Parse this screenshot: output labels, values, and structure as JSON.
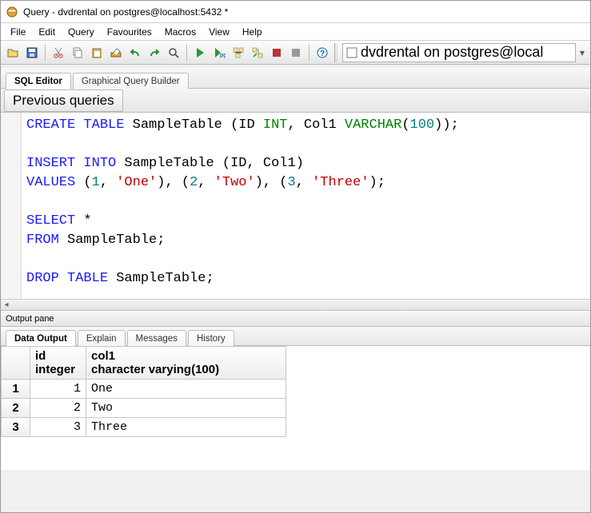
{
  "window": {
    "title": "Query - dvdrental on postgres@localhost:5432 *"
  },
  "menu": {
    "items": [
      "File",
      "Edit",
      "Query",
      "Favourites",
      "Macros",
      "View",
      "Help"
    ]
  },
  "connection": {
    "label": "dvdrental on postgres@local"
  },
  "editor_tabs": {
    "items": [
      "SQL Editor",
      "Graphical Query Builder"
    ],
    "active": 0
  },
  "prev_queries": {
    "label": "Previous queries"
  },
  "sql": {
    "tokens": [
      [
        {
          "t": "CREATE",
          "c": "kw"
        },
        {
          "t": " "
        },
        {
          "t": "TABLE",
          "c": "kw"
        },
        {
          "t": " SampleTable "
        },
        {
          "t": "(",
          "c": ""
        },
        {
          "t": "ID "
        },
        {
          "t": "INT",
          "c": "ty"
        },
        {
          "t": ","
        },
        {
          "t": " Col1 "
        },
        {
          "t": "VARCHAR",
          "c": "ty"
        },
        {
          "t": "("
        },
        {
          "t": "100",
          "c": "num"
        },
        {
          "t": ")"
        },
        {
          "t": ")"
        },
        {
          "t": ";"
        }
      ],
      [],
      [
        {
          "t": "INSERT",
          "c": "kw"
        },
        {
          "t": " "
        },
        {
          "t": "INTO",
          "c": "kw"
        },
        {
          "t": " SampleTable "
        },
        {
          "t": "("
        },
        {
          "t": "ID"
        },
        {
          "t": ","
        },
        {
          "t": " Col1"
        },
        {
          "t": ")"
        }
      ],
      [
        {
          "t": "VALUES",
          "c": "kw"
        },
        {
          "t": " "
        },
        {
          "t": "("
        },
        {
          "t": "1",
          "c": "num"
        },
        {
          "t": ","
        },
        {
          "t": " "
        },
        {
          "t": "'One'",
          "c": "str"
        },
        {
          "t": ")"
        },
        {
          "t": ","
        },
        {
          "t": " "
        },
        {
          "t": "("
        },
        {
          "t": "2",
          "c": "num"
        },
        {
          "t": ","
        },
        {
          "t": " "
        },
        {
          "t": "'Two'",
          "c": "str"
        },
        {
          "t": ")"
        },
        {
          "t": ","
        },
        {
          "t": " "
        },
        {
          "t": "("
        },
        {
          "t": "3",
          "c": "num"
        },
        {
          "t": ","
        },
        {
          "t": " "
        },
        {
          "t": "'Three'",
          "c": "str"
        },
        {
          "t": ")"
        },
        {
          "t": ";"
        }
      ],
      [],
      [
        {
          "t": "SELECT",
          "c": "kw"
        },
        {
          "t": " "
        },
        {
          "t": "*",
          "c": ""
        }
      ],
      [
        {
          "t": "FROM",
          "c": "kw"
        },
        {
          "t": " SampleTable"
        },
        {
          "t": ";"
        }
      ],
      [],
      [
        {
          "t": "DROP",
          "c": "kw"
        },
        {
          "t": " "
        },
        {
          "t": "TABLE",
          "c": "kw"
        },
        {
          "t": " SampleTable"
        },
        {
          "t": ";"
        }
      ]
    ]
  },
  "output": {
    "pane_label": "Output pane",
    "tabs": [
      "Data Output",
      "Explain",
      "Messages",
      "History"
    ],
    "active_tab": 0,
    "columns": [
      {
        "name": "id",
        "type": "integer"
      },
      {
        "name": "col1",
        "type": "character varying(100)"
      }
    ],
    "rows": [
      {
        "n": "1",
        "id": "1",
        "col1": "One"
      },
      {
        "n": "2",
        "id": "2",
        "col1": "Two"
      },
      {
        "n": "3",
        "id": "3",
        "col1": "Three"
      }
    ]
  }
}
